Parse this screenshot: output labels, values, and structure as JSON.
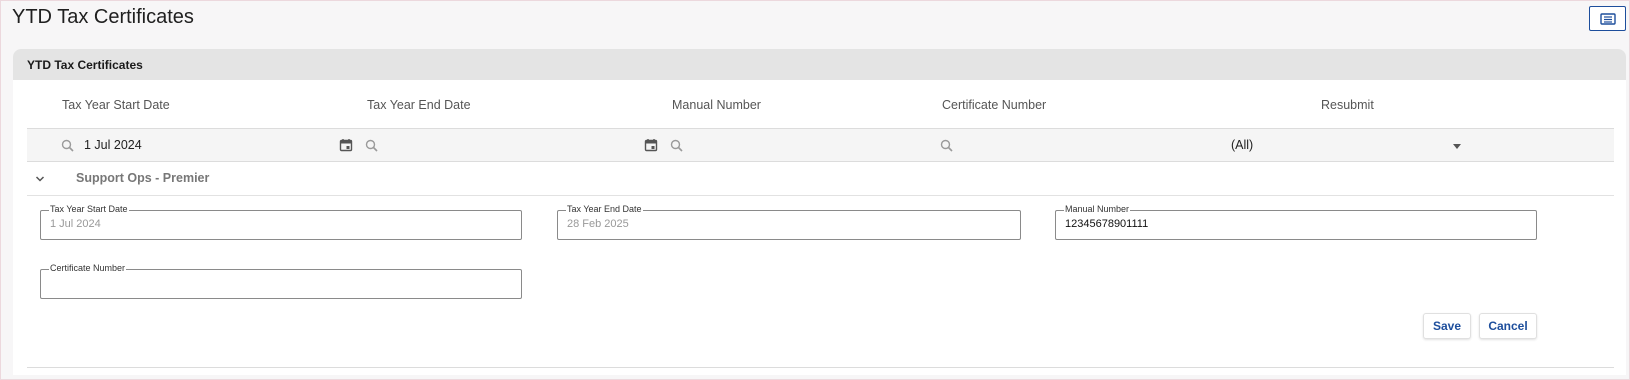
{
  "page": {
    "title": "YTD Tax Certificates"
  },
  "toolbar": {
    "view_icon": "list-view-icon"
  },
  "panel": {
    "title": "YTD Tax Certificates"
  },
  "grid": {
    "columns": [
      "Tax Year Start Date",
      "Tax Year End Date",
      "Manual Number",
      "Certificate Number",
      "Resubmit"
    ],
    "filters": {
      "start_date": "1 Jul 2024",
      "end_date": "",
      "manual_number": "",
      "certificate_number": "",
      "resubmit": "(All)"
    }
  },
  "group": {
    "label": "Support Ops - Premier",
    "expanded": true
  },
  "form": {
    "start_date": {
      "label": "Tax Year Start Date",
      "value": "1 Jul 2024"
    },
    "end_date": {
      "label": "Tax Year End Date",
      "value": "28 Feb 2025"
    },
    "manual_number": {
      "label": "Manual Number",
      "value": "12345678901111"
    },
    "certificate_number": {
      "label": "Certificate Number",
      "value": ""
    }
  },
  "actions": {
    "save": "Save",
    "cancel": "Cancel"
  },
  "colors": {
    "accent": "#1d4e9c",
    "header_bg": "#e4e4e4"
  }
}
